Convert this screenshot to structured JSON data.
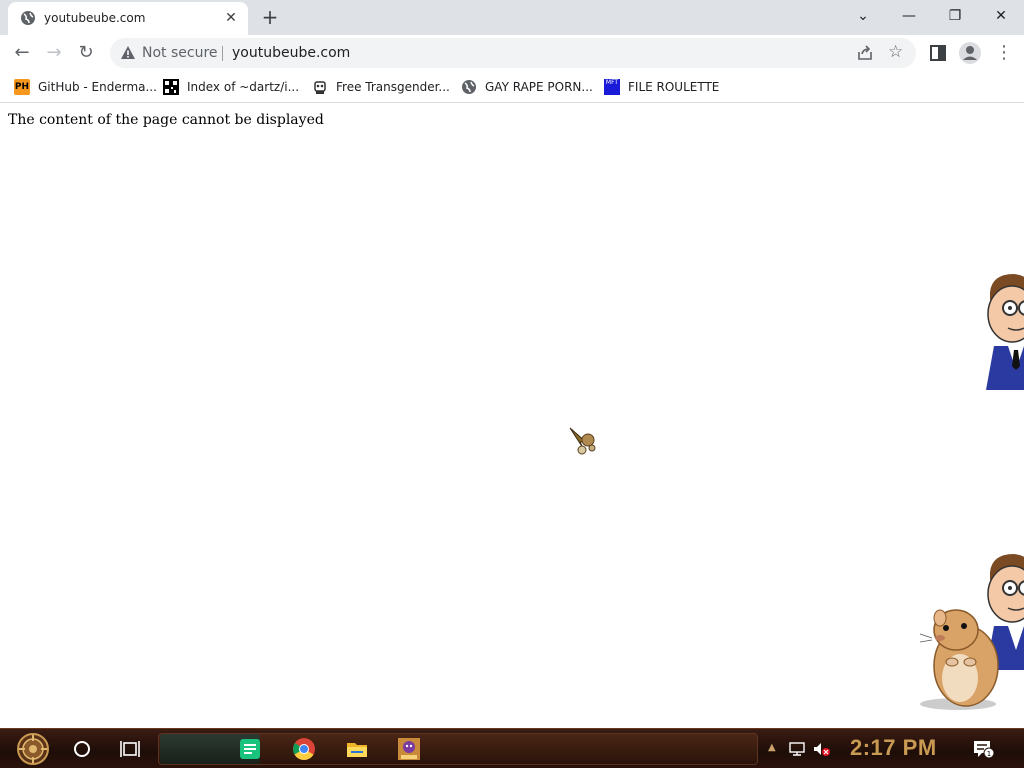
{
  "tab": {
    "title": "youtubeube.com",
    "favicon": "globe-icon"
  },
  "window_controls": {
    "tab_search": "⌄",
    "minimize": "—",
    "maximize": "❐",
    "close": "✕"
  },
  "toolbar": {
    "back": "←",
    "forward": "→",
    "reload": "↻",
    "security_label": "Not secure",
    "url": "youtubeube.com",
    "bookmark_star": "☆",
    "menu": "⋮"
  },
  "bookmarks": [
    {
      "label": "GitHub - Enderma...",
      "icon": "ph-icon",
      "icon_text": "PH"
    },
    {
      "label": "Index of ~dartz/i...",
      "icon": "qr-icon"
    },
    {
      "label": "Free Transgender...",
      "icon": "robot-icon"
    },
    {
      "label": "GAY RAPE PORN...",
      "icon": "globe-icon"
    },
    {
      "label": "FILE ROULETTE",
      "icon": "mft-icon",
      "icon_text": "MFT"
    }
  ],
  "page": {
    "message": "The content of the page cannot be displayed"
  },
  "taskbar": {
    "clock": "2:17 PM",
    "notification_count": "1"
  },
  "colors": {
    "tabstrip": "#dee1e6",
    "omnibox": "#f1f3f4",
    "taskbar": "#2a120a",
    "clock": "#c99a52"
  }
}
